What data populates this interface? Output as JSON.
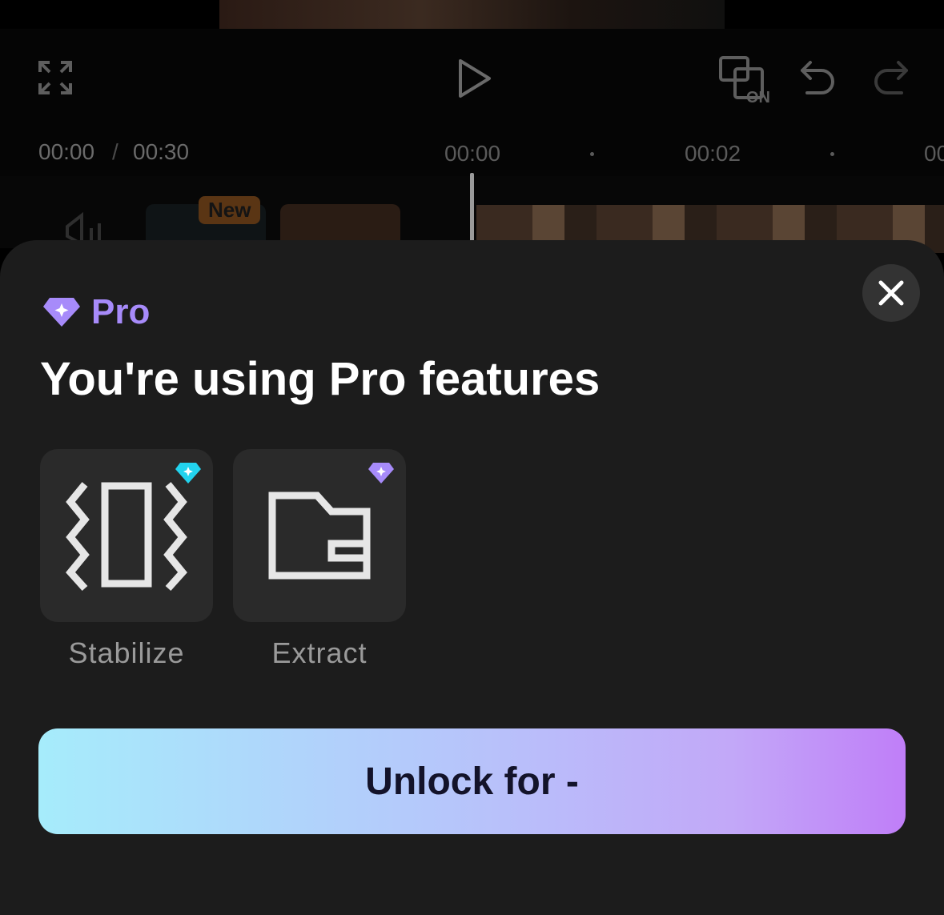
{
  "editor": {
    "current_time": "00:00",
    "separator": "/",
    "total_time": "00:30",
    "ruler_marks": [
      "00:00",
      "00:02",
      "00"
    ],
    "badge_new": "New",
    "on_label": "ON"
  },
  "sheet": {
    "pro_label": "Pro",
    "title": "You're using Pro features",
    "features": [
      {
        "label": "Stabilize",
        "icon": "stabilize-icon",
        "gem_color": "#22d3ee"
      },
      {
        "label": "Extract",
        "icon": "extract-folder-icon",
        "gem_color": "#a78bfa"
      }
    ],
    "unlock_label": "Unlock for -"
  },
  "colors": {
    "pro_accent": "#a78bfa",
    "sheet_bg": "#1c1c1c",
    "tile_bg": "#2a2a2a",
    "gradient_start": "#a6ecfb",
    "gradient_end": "#c07ef8"
  }
}
